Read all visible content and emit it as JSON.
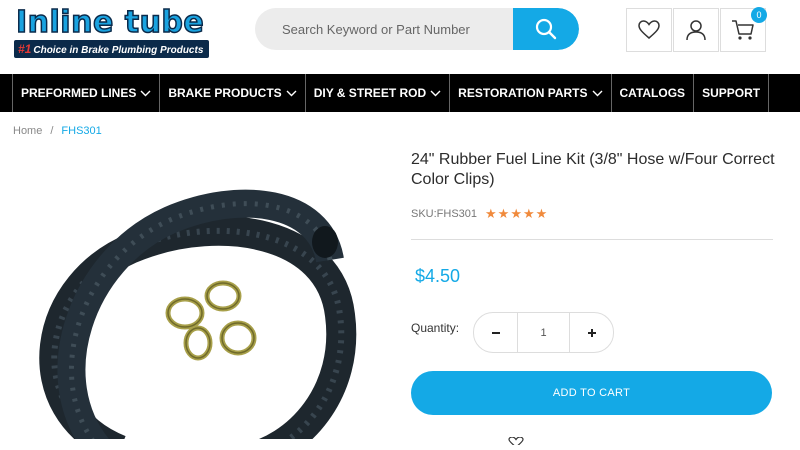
{
  "header": {
    "logo": {
      "name": "Inline tube",
      "tagline_number": "#1",
      "tagline": "Choice in Brake Plumbing Products"
    },
    "search": {
      "placeholder": "Search Keyword or Part Number"
    },
    "icons": {
      "wishlist": "heart-icon",
      "account": "user-icon",
      "cart": "cart-icon"
    },
    "cart_count": "0"
  },
  "nav": {
    "items": [
      {
        "label": "PREFORMED LINES",
        "has_dropdown": true
      },
      {
        "label": "BRAKE PRODUCTS",
        "has_dropdown": true
      },
      {
        "label": "DIY & STREET ROD",
        "has_dropdown": true
      },
      {
        "label": "RESTORATION PARTS",
        "has_dropdown": true
      },
      {
        "label": "CATALOGS",
        "has_dropdown": false
      },
      {
        "label": "SUPPORT",
        "has_dropdown": false
      }
    ]
  },
  "breadcrumb": {
    "home": "Home",
    "separator": "/",
    "current": "FHS301"
  },
  "product": {
    "title": "24\" Rubber Fuel Line Kit (3/8\" Hose w/Four Correct Color Clips)",
    "sku": "SKU:FHS301",
    "rating_stars": "★★★★★",
    "rating": 5,
    "price": "$4.50",
    "quantity_label": "Quantity:",
    "quantity": "1",
    "add_to_cart": "ADD TO CART"
  },
  "colors": {
    "accent": "#14a9e6",
    "nav_bg": "#000000",
    "star": "#f08a3c",
    "logo_dark": "#0b2a4a"
  }
}
